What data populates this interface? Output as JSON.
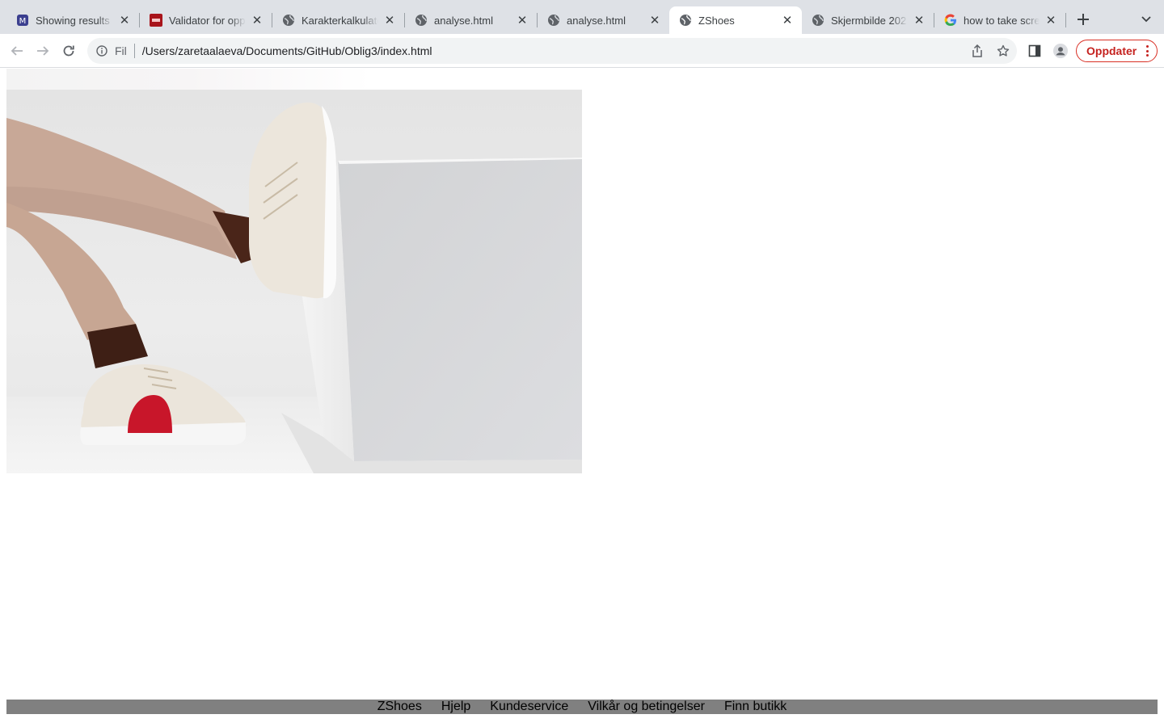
{
  "browser": {
    "tabs": [
      {
        "title": "Showing results",
        "icon": "monkey-icon",
        "active": false
      },
      {
        "title": "Validator for opp",
        "icon": "validator-icon",
        "active": false
      },
      {
        "title": "Karakterkalkulato",
        "icon": "globe-icon",
        "active": false
      },
      {
        "title": "analyse.html",
        "icon": "globe-icon",
        "active": false
      },
      {
        "title": "analyse.html",
        "icon": "globe-icon",
        "active": false
      },
      {
        "title": "ZShoes",
        "icon": "globe-icon",
        "active": true
      },
      {
        "title": "Skjermbilde 202",
        "icon": "globe-icon",
        "active": false
      },
      {
        "title": "how to take scre",
        "icon": "google-icon",
        "active": false
      }
    ],
    "omnibox": {
      "scheme_label": "Fil",
      "url": "/Users/zaretaalaeva/Documents/GitHub/Oblig3/index.html"
    },
    "update_label": "Oppdater"
  },
  "page": {
    "hero_alt": "Christian Louboutin sneakers",
    "footer_links": [
      "ZShoes",
      "Hjelp",
      "Kundeservice",
      "Vilkår og betingelser",
      "Finn butikk"
    ]
  }
}
